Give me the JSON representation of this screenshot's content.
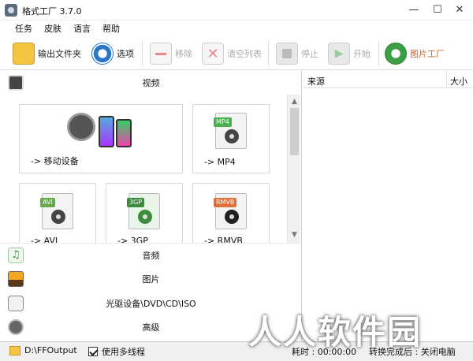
{
  "window": {
    "title": "格式工厂 3.7.0",
    "minimize": "—",
    "maximize": "☐",
    "close": "✕"
  },
  "menu": [
    "任务",
    "皮肤",
    "语言",
    "帮助"
  ],
  "toolbar": {
    "output_folder": "输出文件夹",
    "options": "选项",
    "remove": "移除",
    "clear_list": "清空列表",
    "stop": "停止",
    "start": "开始",
    "picture_factory": "图片工厂"
  },
  "categories": {
    "video": "视频",
    "audio": "音频",
    "image": "图片",
    "optical": "光驱设备\\DVD\\CD\\ISO",
    "advanced": "高级"
  },
  "video_cards": [
    {
      "label": "-> 移动设备"
    },
    {
      "label": "-> MP4",
      "tag": "MP4",
      "tag_color": "#4caf50"
    },
    {
      "label": "-> AVI",
      "tag": "AVI",
      "tag_color": "#6aa84f"
    },
    {
      "label": "-> 3GP",
      "tag": "3GP",
      "tag_color": "#3d8b3d"
    },
    {
      "label": "-> RMVB",
      "tag": "RMVB",
      "tag_color": "#e0703a"
    }
  ],
  "columns": {
    "source": "来源",
    "size": "大小"
  },
  "status": {
    "output_path": "D:\\FFOutput",
    "multithread": "使用多线程",
    "elapsed": "耗时 : 00:00:00",
    "after_convert": "转换完成后 : 关闭电脑"
  },
  "watermark": "人人软件园",
  "colors": {
    "accent_green": "#4caf50",
    "status_bg": "#f0f0f0"
  }
}
